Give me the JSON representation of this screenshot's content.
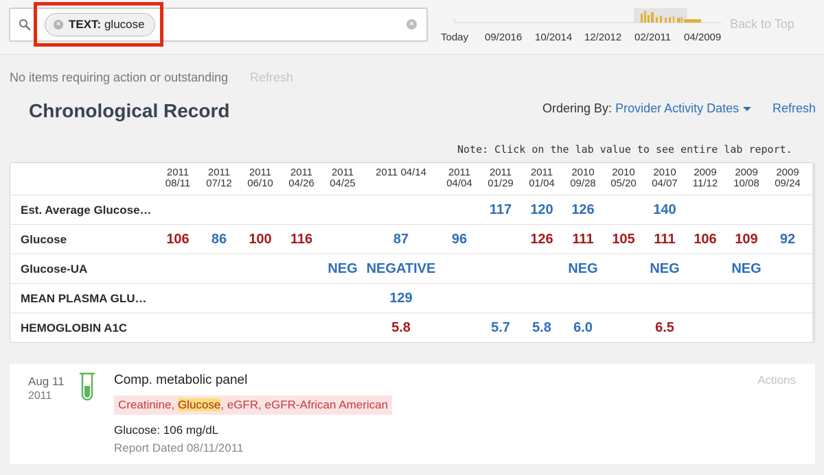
{
  "search": {
    "chip_key": "TEXT:",
    "chip_value": "glucose"
  },
  "timeline": {
    "labels": [
      "Today",
      "09/2016",
      "10/2014",
      "12/2012",
      "02/2011",
      "04/2009"
    ],
    "accent_color": "#e2b23a"
  },
  "header": {
    "back_to_top": "Back to Top"
  },
  "status": {
    "message": "No items requiring action or outstanding",
    "refresh_label": "Refresh"
  },
  "record": {
    "title": "Chronological Record",
    "ordering_label": "Ordering By:",
    "ordering_value": "Provider Activity Dates",
    "refresh_label": "Refresh",
    "note": "Note: Click on the lab value to see entire lab report."
  },
  "table": {
    "dates": [
      {
        "line1": "2011",
        "line2": "08/11"
      },
      {
        "line1": "2011",
        "line2": "07/12"
      },
      {
        "line1": "2011",
        "line2": "06/10"
      },
      {
        "line1": "2011",
        "line2": "04/26"
      },
      {
        "line1": "2011",
        "line2": "04/25"
      },
      {
        "line1": "2011 04/14",
        "line2": ""
      },
      {
        "line1": "2011",
        "line2": "04/04"
      },
      {
        "line1": "2011",
        "line2": "01/29"
      },
      {
        "line1": "2011",
        "line2": "01/04"
      },
      {
        "line1": "2010",
        "line2": "09/28"
      },
      {
        "line1": "2010",
        "line2": "05/20"
      },
      {
        "line1": "2010",
        "line2": "04/07"
      },
      {
        "line1": "2009",
        "line2": "11/12"
      },
      {
        "line1": "2009",
        "line2": "10/08"
      },
      {
        "line1": "2009",
        "line2": "09/24"
      }
    ],
    "rows": [
      {
        "label": "Est. Average Glucose…",
        "cells": [
          {
            "col": 7,
            "value": "117",
            "status": "normal"
          },
          {
            "col": 8,
            "value": "120",
            "status": "normal"
          },
          {
            "col": 9,
            "value": "126",
            "status": "normal"
          },
          {
            "col": 11,
            "value": "140",
            "status": "normal"
          }
        ]
      },
      {
        "label": "Glucose",
        "cells": [
          {
            "col": 0,
            "value": "106",
            "status": "abnormal"
          },
          {
            "col": 1,
            "value": "86",
            "status": "normal"
          },
          {
            "col": 2,
            "value": "100",
            "status": "abnormal"
          },
          {
            "col": 3,
            "value": "116",
            "status": "abnormal"
          },
          {
            "col": 5,
            "value": "87",
            "status": "normal"
          },
          {
            "col": 6,
            "value": "96",
            "status": "normal"
          },
          {
            "col": 8,
            "value": "126",
            "status": "abnormal"
          },
          {
            "col": 9,
            "value": "111",
            "status": "abnormal"
          },
          {
            "col": 10,
            "value": "105",
            "status": "abnormal"
          },
          {
            "col": 11,
            "value": "111",
            "status": "abnormal"
          },
          {
            "col": 12,
            "value": "106",
            "status": "abnormal"
          },
          {
            "col": 13,
            "value": "109",
            "status": "abnormal"
          },
          {
            "col": 14,
            "value": "92",
            "status": "normal"
          }
        ]
      },
      {
        "label": "Glucose-UA",
        "cells": [
          {
            "col": 4,
            "value": "NEG",
            "status": "normal"
          },
          {
            "col": 5,
            "value": "NEGATIVE",
            "status": "normal"
          },
          {
            "col": 9,
            "value": "NEG",
            "status": "normal"
          },
          {
            "col": 11,
            "value": "NEG",
            "status": "normal"
          },
          {
            "col": 13,
            "value": "NEG",
            "status": "normal"
          }
        ]
      },
      {
        "label": "MEAN PLASMA GLU…",
        "cells": [
          {
            "col": 5,
            "value": "129",
            "status": "normal"
          }
        ]
      },
      {
        "label": "HEMOGLOBIN A1C",
        "cells": [
          {
            "col": 5,
            "value": "5.8",
            "status": "abnormal"
          },
          {
            "col": 7,
            "value": "5.7",
            "status": "normal"
          },
          {
            "col": 8,
            "value": "5.8",
            "status": "normal"
          },
          {
            "col": 9,
            "value": "6.0",
            "status": "normal"
          },
          {
            "col": 11,
            "value": "6.5",
            "status": "abnormal"
          }
        ]
      }
    ],
    "colors": {
      "normal": "#2f6eb8",
      "abnormal": "#a51c1c"
    }
  },
  "result_card": {
    "month_day": "Aug 11",
    "year": "2011",
    "icon": "test-tube-icon",
    "title": "Comp. metabolic panel",
    "actions_label": "Actions",
    "tests_before": "Creatinine, ",
    "tests_match": "Glucose",
    "tests_after": ", eGFR, eGFR-African American",
    "result_line": "Glucose: 106 mg/dL",
    "report_dated": "Report Dated 08/11/2011"
  }
}
